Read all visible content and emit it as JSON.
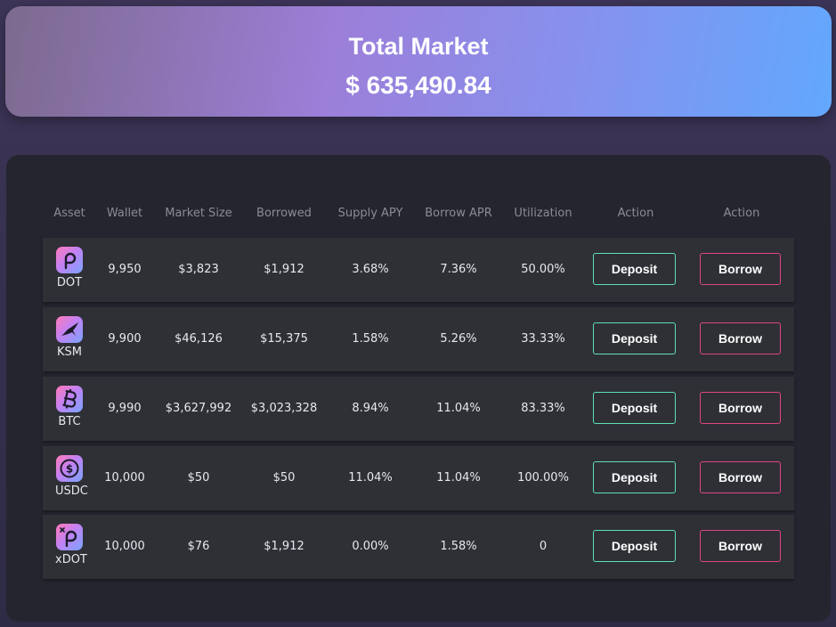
{
  "header": {
    "title": "Total Market",
    "value": "$ 635,490.84"
  },
  "table": {
    "columns": [
      "Asset",
      "Wallet",
      "Market Size",
      "Borrowed",
      "Supply APY",
      "Borrow APR",
      "Utilization",
      "Action",
      "Action"
    ],
    "rows": [
      {
        "icon": "polkadot-icon",
        "asset": "DOT",
        "wallet": "9,950",
        "market_size": "$3,823",
        "borrowed": "$1,912",
        "supply_apy": "3.68%",
        "borrow_apr": "7.36%",
        "utilization": "50.00%",
        "deposit": "Deposit",
        "borrow": "Borrow"
      },
      {
        "icon": "kusama-icon",
        "asset": "KSM",
        "wallet": "9,900",
        "market_size": "$46,126",
        "borrowed": "$15,375",
        "supply_apy": "1.58%",
        "borrow_apr": "5.26%",
        "utilization": "33.33%",
        "deposit": "Deposit",
        "borrow": "Borrow"
      },
      {
        "icon": "bitcoin-icon",
        "asset": "BTC",
        "wallet": "9,990",
        "market_size": "$3,627,992",
        "borrowed": "$3,023,328",
        "supply_apy": "8.94%",
        "borrow_apr": "11.04%",
        "utilization": "83.33%",
        "deposit": "Deposit",
        "borrow": "Borrow"
      },
      {
        "icon": "usdc-icon",
        "asset": "USDC",
        "wallet": "10,000",
        "market_size": "$50",
        "borrowed": "$50",
        "supply_apy": "11.04%",
        "borrow_apr": "11.04%",
        "utilization": "100.00%",
        "deposit": "Deposit",
        "borrow": "Borrow"
      },
      {
        "icon": "xdot-icon",
        "asset": "xDOT",
        "wallet": "10,000",
        "market_size": "$76",
        "borrowed": "$1,912",
        "supply_apy": "0.00%",
        "borrow_apr": "1.58%",
        "utilization": "0",
        "deposit": "Deposit",
        "borrow": "Borrow"
      }
    ]
  },
  "colors": {
    "deposit_border": "#5ee0b2",
    "borrow_border": "#e0467f",
    "panel_bg": "#24252f",
    "row_bg": "#2e3036"
  }
}
